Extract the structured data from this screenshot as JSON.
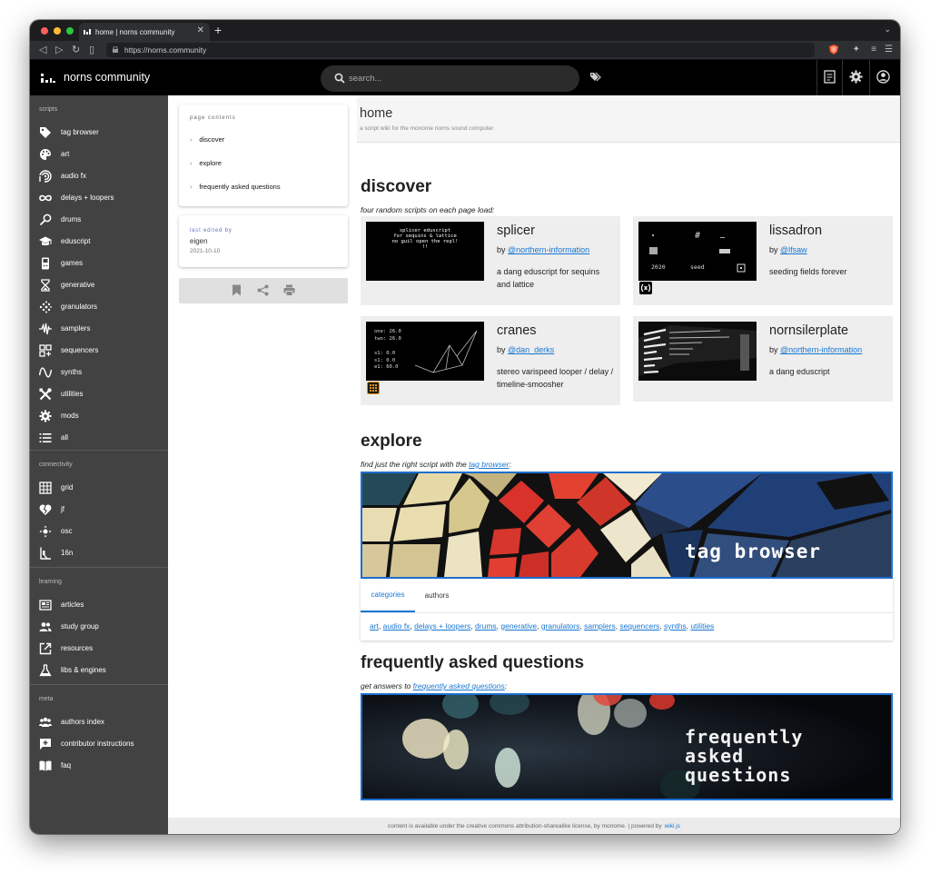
{
  "browser": {
    "tab_title": "home | norns community",
    "close_glyph": "✕",
    "new_tab_glyph": "+",
    "url": "https://norns.community"
  },
  "app": {
    "brand": "norns community",
    "search_placeholder": "search..."
  },
  "sidebar": {
    "sections": [
      {
        "title": "scripts",
        "items": [
          {
            "label": "tag browser",
            "icon": "tag-icon"
          },
          {
            "label": "art",
            "icon": "palette-icon"
          },
          {
            "label": "audio fx",
            "icon": "spiral-icon"
          },
          {
            "label": "delays + loopers",
            "icon": "infinity-icon"
          },
          {
            "label": "drums",
            "icon": "drumstick-icon"
          },
          {
            "label": "eduscript",
            "icon": "graduation-cap-icon"
          },
          {
            "label": "games",
            "icon": "gamepad-icon"
          },
          {
            "label": "generative",
            "icon": "hourglass-icon"
          },
          {
            "label": "granulators",
            "icon": "dots-grain-icon"
          },
          {
            "label": "samplers",
            "icon": "waveform-icon"
          },
          {
            "label": "sequencers",
            "icon": "grid-plus-icon"
          },
          {
            "label": "synths",
            "icon": "sine-wave-icon"
          },
          {
            "label": "utilities",
            "icon": "tools-icon"
          },
          {
            "label": "mods",
            "icon": "gear-icon"
          },
          {
            "label": "all",
            "icon": "list-icon"
          }
        ]
      },
      {
        "title": "connectivity",
        "items": [
          {
            "label": "grid",
            "icon": "grid-icon"
          },
          {
            "label": "jf",
            "icon": "heart-broken-icon"
          },
          {
            "label": "osc",
            "icon": "network-icon"
          },
          {
            "label": "16n",
            "icon": "fader-icon"
          }
        ]
      },
      {
        "title": "learning",
        "items": [
          {
            "label": "articles",
            "icon": "newspaper-icon"
          },
          {
            "label": "study group",
            "icon": "group-icon"
          },
          {
            "label": "resources",
            "icon": "external-link-icon"
          },
          {
            "label": "libs & engines",
            "icon": "flask-icon"
          }
        ]
      },
      {
        "title": "meta",
        "items": [
          {
            "label": "authors index",
            "icon": "people-icon"
          },
          {
            "label": "contributor instructions",
            "icon": "add-comment-icon"
          },
          {
            "label": "faq",
            "icon": "book-icon"
          }
        ]
      }
    ]
  },
  "page_contents": {
    "title": "page contents",
    "chevron": "›",
    "items": [
      "discover",
      "explore",
      "frequently asked questions"
    ]
  },
  "last_edited": {
    "label": "last edited by",
    "name": "eigen",
    "date": "2021-10-10"
  },
  "header": {
    "title": "home",
    "subtitle": "a script wiki for the monome norns sound computer"
  },
  "discover": {
    "heading": "discover",
    "lead": "four random scripts on each page load:",
    "by_prefix": "by ",
    "cards": [
      {
        "title": "splicer",
        "author": "@northern-information",
        "desc": "a dang eduscript for sequins and lattice",
        "thumb_lines": [
          "splicer eduscript",
          "for sequins & lattice",
          "no guil open the repl!",
          "!!"
        ]
      },
      {
        "title": "lissadron",
        "author": "@lfsaw",
        "desc": "seeding fields forever",
        "thumb_text": [
          "#",
          "2020",
          "seed"
        ]
      },
      {
        "title": "cranes",
        "author": "@dan_derks",
        "desc": "stereo varispeed looper / delay / timeline-smoosher",
        "thumb_lines": [
          "one: 26.0",
          "two: 26.0",
          "s1: 0.0",
          "s1: 0.0",
          "e1: 60.0"
        ]
      },
      {
        "title": "nornsilerplate",
        "author": "@northern-information",
        "desc": "a dang eduscript"
      }
    ]
  },
  "explore": {
    "heading": "explore",
    "lead_prefix": "find just the right script with the ",
    "lead_link": "tag browser",
    "lead_suffix": ":",
    "banner_text": "tag browser",
    "tabs": [
      "categories",
      "authors"
    ],
    "categories": [
      "art",
      "audio fx",
      "delays + loopers",
      "drums",
      "generative",
      "granulators",
      "samplers",
      "sequencers",
      "synths",
      "utilities"
    ]
  },
  "faq": {
    "heading": "frequently asked questions",
    "lead_prefix": "get answers to ",
    "lead_link": "frequently asked questions",
    "lead_suffix": ":",
    "banner_lines": [
      "frequently",
      "asked",
      "questions"
    ]
  },
  "footer": {
    "text": "content is available under the creative commons attribution-sharealike license, by monome. | powered by",
    "link": "wiki.js"
  },
  "colors": {
    "accent": "#1976d2",
    "sidebar": "#424242",
    "appbar": "#000000",
    "banner_border": "#1e6fd0"
  }
}
